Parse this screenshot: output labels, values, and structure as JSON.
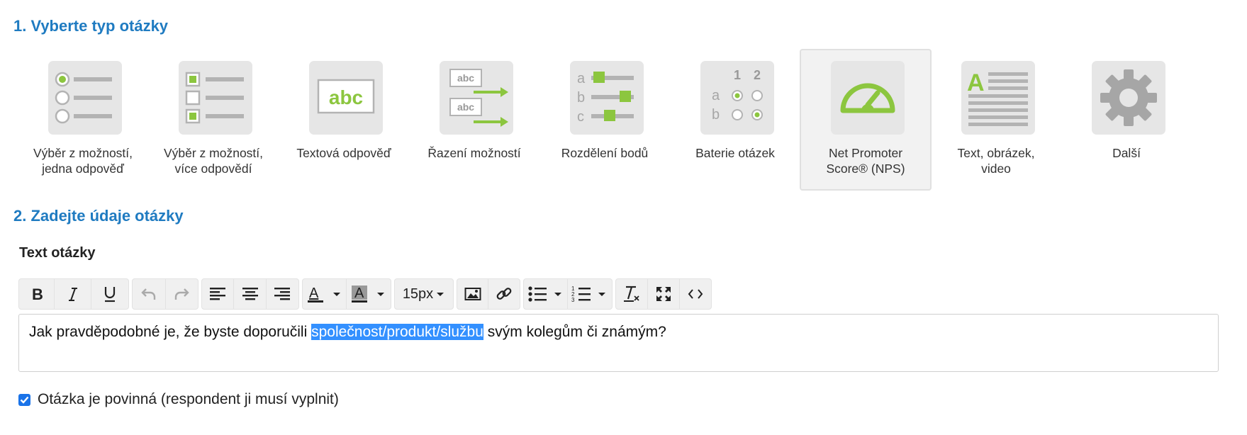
{
  "step1": {
    "title": "1. Vyberte typ otázky"
  },
  "question_types": [
    {
      "label": "Výběr z možností,\njedna odpověď",
      "icon": "radio-list-icon",
      "selected": false
    },
    {
      "label": "Výběr z možností,\nvíce odpovědí",
      "icon": "checkbox-list-icon",
      "selected": false
    },
    {
      "label": "Textová odpověď",
      "icon": "text-box-icon",
      "selected": false
    },
    {
      "label": "Řazení možností",
      "icon": "ranking-arrows-icon",
      "selected": false
    },
    {
      "label": "Rozdělení bodů",
      "icon": "slider-points-icon",
      "selected": false
    },
    {
      "label": "Baterie otázek",
      "icon": "matrix-grid-icon",
      "selected": false
    },
    {
      "label": "Net Promoter\nScore® (NPS)",
      "icon": "gauge-icon",
      "selected": true
    },
    {
      "label": "Text, obrázek,\nvideo",
      "icon": "text-image-icon",
      "selected": false
    },
    {
      "label": "Další",
      "icon": "gear-icon",
      "selected": false
    }
  ],
  "icon_text": {
    "abc": "abc",
    "a": "a",
    "b": "b",
    "c": "c",
    "n1": "1",
    "n2": "2",
    "A": "A"
  },
  "step2": {
    "title": "2. Zadejte údaje otázky"
  },
  "field": {
    "label": "Text otázky"
  },
  "toolbar": {
    "font_size": "15px",
    "buttons": [
      "bold",
      "italic",
      "underline",
      "undo",
      "redo",
      "align-left",
      "align-center",
      "align-right",
      "text-color",
      "background-color",
      "font-size",
      "insert-image",
      "insert-link",
      "bullet-list",
      "numbered-list",
      "clear-formatting",
      "fullscreen",
      "source-code"
    ]
  },
  "editor": {
    "text_before": "Jak pravděpodobné je, že byste doporučili ",
    "text_selected": "společnost/produkt/službu",
    "text_after": " svým kolegům či známým?"
  },
  "required": {
    "label": "Otázka je povinná (respondent ji musí vyplnit)",
    "checked": true
  },
  "colors": {
    "accent_green": "#8cc63f",
    "icon_gray": "#b3b3b3",
    "title_blue": "#1f7bc1",
    "selection_blue": "#3390ff"
  }
}
